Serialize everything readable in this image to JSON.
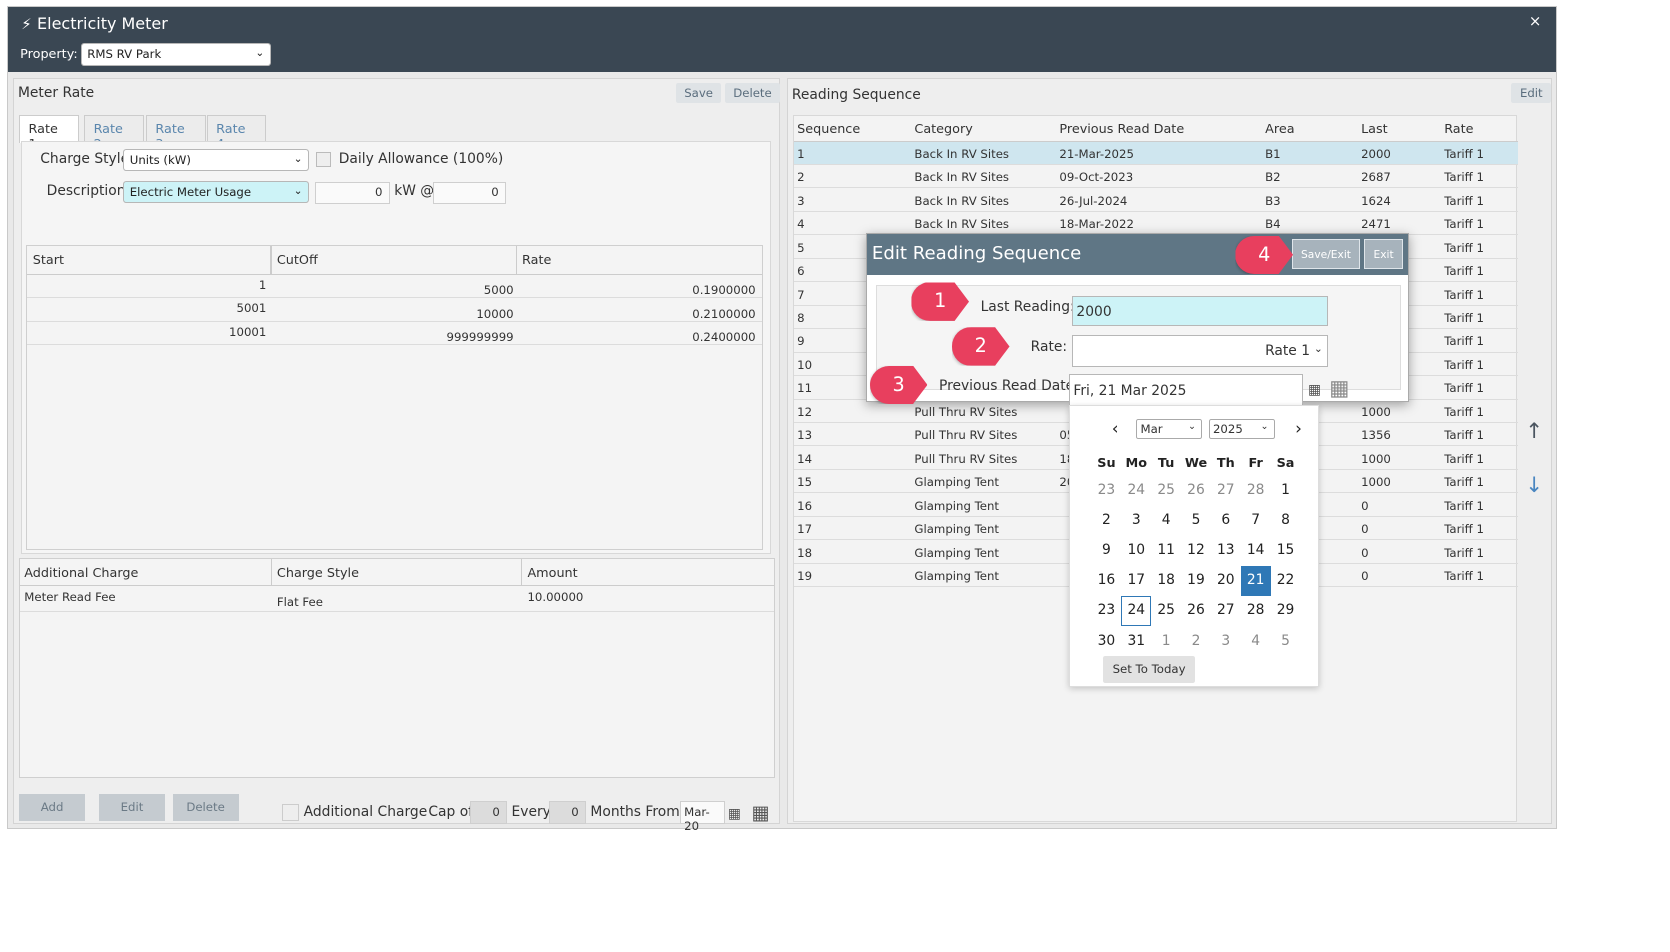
{
  "window": {
    "title": "Electricity Meter",
    "close": "×",
    "property_label": "Property:",
    "property_value": "RMS RV Park"
  },
  "meter_rate": {
    "title": "Meter Rate",
    "save": "Save",
    "delete": "Delete",
    "tabs": [
      "Rate 1",
      "Rate 2",
      "Rate 3",
      "Rate 4"
    ],
    "charge_style_label": "Charge Style",
    "charge_style_value": "Units (kW)",
    "daily_allowance": "Daily Allowance (100%)",
    "description_label": "Description",
    "description_value": "Electric Meter Usage",
    "kw_value": "0",
    "kw_label": "kW @",
    "at_value": "0",
    "grid_headers": [
      "Start",
      "CutOff",
      "Rate"
    ],
    "grid_rows": [
      [
        "1",
        "5000",
        "0.1900000"
      ],
      [
        "5001",
        "10000",
        "0.2100000"
      ],
      [
        "10001",
        "999999999",
        "0.2400000"
      ]
    ],
    "add_headers": [
      "Additional Charge",
      "Charge Style",
      "Amount"
    ],
    "add_rows": [
      [
        "Meter Read Fee",
        "Flat Fee",
        "10.00000"
      ]
    ],
    "footer": {
      "add": "Add",
      "edit": "Edit",
      "delete": "Delete",
      "additional_charge": "Additional Charge",
      "cap_of": "Cap of",
      "cap_value": "0",
      "every": "Every",
      "every_value": "0",
      "months_from": "Months From",
      "months_value": "Mar-20"
    }
  },
  "reading_sequence": {
    "title": "Reading Sequence",
    "edit": "Edit",
    "headers": [
      "Sequence",
      "Category",
      "Previous Read Date",
      "Area",
      "Last",
      "Rate"
    ],
    "rows": [
      [
        "1",
        "Back In RV Sites",
        "21-Mar-2025",
        "B1",
        "2000",
        "Tariff 1"
      ],
      [
        "2",
        "Back In RV Sites",
        "09-Oct-2023",
        "B2",
        "2687",
        "Tariff 1"
      ],
      [
        "3",
        "Back In RV Sites",
        "26-Jul-2024",
        "B3",
        "1624",
        "Tariff 1"
      ],
      [
        "4",
        "Back In RV Sites",
        "18-Mar-2022",
        "B4",
        "2471",
        "Tariff 1"
      ],
      [
        "5",
        "",
        "",
        "",
        "",
        "Tariff 1"
      ],
      [
        "6",
        "",
        "",
        "",
        "",
        "Tariff 1"
      ],
      [
        "7",
        "",
        "",
        "",
        "",
        "Tariff 1"
      ],
      [
        "8",
        "",
        "",
        "",
        "",
        "Tariff 1"
      ],
      [
        "9",
        "",
        "",
        "",
        "",
        "Tariff 1"
      ],
      [
        "10",
        "",
        "",
        "",
        "",
        "Tariff 1"
      ],
      [
        "11",
        "",
        "",
        "",
        "",
        "Tariff 1"
      ],
      [
        "12",
        "Pull Thru RV Sites",
        "",
        "",
        "1000",
        "Tariff 1"
      ],
      [
        "13",
        "Pull Thru RV Sites",
        "05",
        "",
        "1356",
        "Tariff 1"
      ],
      [
        "14",
        "Pull Thru RV Sites",
        "18",
        "",
        "1000",
        "Tariff 1"
      ],
      [
        "15",
        "Glamping Tent",
        "20",
        "",
        "1000",
        "Tariff 1"
      ],
      [
        "16",
        "Glamping Tent",
        "",
        "",
        "0",
        "Tariff 1"
      ],
      [
        "17",
        "Glamping Tent",
        "",
        "",
        "0",
        "Tariff 1"
      ],
      [
        "18",
        "Glamping Tent",
        "",
        "",
        "0",
        "Tariff 1"
      ],
      [
        "19",
        "Glamping Tent",
        "",
        "",
        "0",
        "Tariff 1"
      ]
    ],
    "up_arrow": "↑",
    "down_arrow": "↓"
  },
  "dialog": {
    "title": "Edit Reading Sequence",
    "save_exit": "Save/Exit",
    "exit": "Exit",
    "last_reading_label": "Last Reading:",
    "last_reading_value": "2000",
    "rate_label": "Rate:",
    "rate_value": "Rate 1",
    "prev_date_label": "Previous Read Date:",
    "prev_date_value": "Fri, 21 Mar 2025",
    "markers": [
      "1",
      "2",
      "3",
      "4"
    ]
  },
  "calendar": {
    "month": "Mar",
    "year": "2025",
    "prev": "‹",
    "next": "›",
    "dow": [
      "Su",
      "Mo",
      "Tu",
      "We",
      "Th",
      "Fr",
      "Sa"
    ],
    "weeks": [
      [
        "23",
        "24",
        "25",
        "26",
        "27",
        "28",
        "1"
      ],
      [
        "2",
        "3",
        "4",
        "5",
        "6",
        "7",
        "8"
      ],
      [
        "9",
        "10",
        "11",
        "12",
        "13",
        "14",
        "15"
      ],
      [
        "16",
        "17",
        "18",
        "19",
        "20",
        "21",
        "22"
      ],
      [
        "23",
        "24",
        "25",
        "26",
        "27",
        "28",
        "29"
      ],
      [
        "30",
        "31",
        "1",
        "2",
        "3",
        "4",
        "5"
      ]
    ],
    "selected": "21",
    "today": "24",
    "set_today": "Set To Today"
  },
  "colors": {
    "header": "#3a4753",
    "dialog_head": "#5f7685",
    "marker": "#e83f5e",
    "accent": "#2f78b6",
    "input_highlight": "#cdf3f7"
  }
}
